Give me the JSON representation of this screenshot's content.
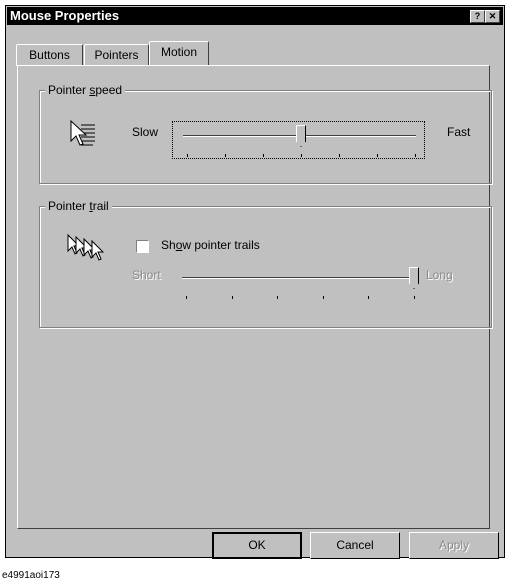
{
  "window": {
    "title": "Mouse Properties",
    "help_label": "?",
    "close_label": "✕"
  },
  "tabs": [
    {
      "label": "Buttons",
      "active": false
    },
    {
      "label": "Pointers",
      "active": false
    },
    {
      "label": "Motion",
      "active": true
    }
  ],
  "pointer_speed": {
    "legend_pre": "Pointer ",
    "legend_u": "s",
    "legend_post": "peed",
    "slow_label": "Slow",
    "fast_label": "Fast",
    "value": 0.5,
    "tick_count": 7,
    "icon": "pointer-speed-icon"
  },
  "pointer_trail": {
    "legend_pre": "Pointer ",
    "legend_u": "t",
    "legend_post": "rail",
    "checkbox_pre": "Sh",
    "checkbox_u": "o",
    "checkbox_post": "w pointer trails",
    "checked": false,
    "short_label": "Short",
    "long_label": "Long",
    "value": 1.0,
    "tick_count": 6,
    "icon": "pointer-trail-icon"
  },
  "buttons": {
    "ok_label": "OK",
    "cancel_label": "Cancel",
    "apply_label": "Apply"
  },
  "caption": "e4991aoi173"
}
